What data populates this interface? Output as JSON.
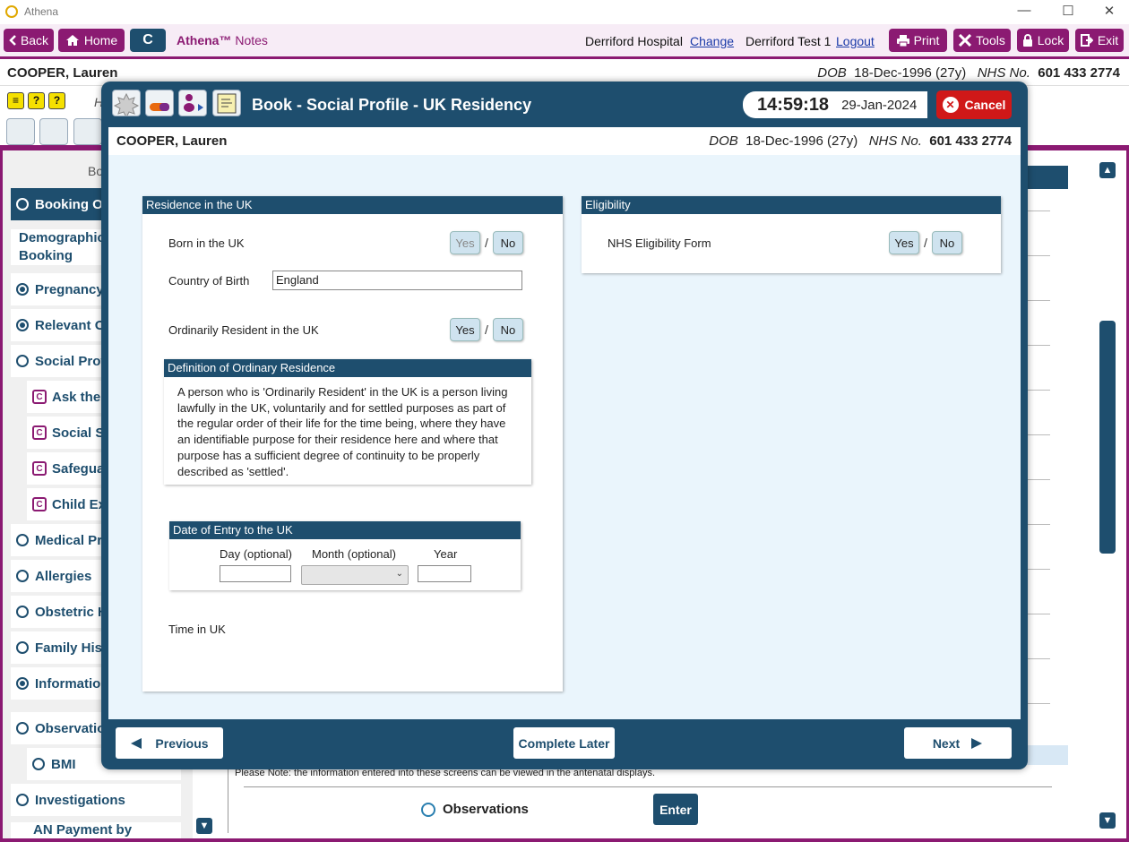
{
  "window": {
    "title": "Athena",
    "minimize": "—",
    "maximize": "☐",
    "close": "✕"
  },
  "nav": {
    "back": "Back",
    "home": "Home",
    "c": "C",
    "brand": "Athena™",
    "brand_suffix": "Notes",
    "hospital": "Derriford Hospital",
    "change": "Change",
    "user": "Derriford Test 1",
    "logout": "Logout",
    "print": "Print",
    "tools": "Tools",
    "lock": "Lock",
    "exit": "Exit"
  },
  "patient": {
    "name": "COOPER, Lauren",
    "dob_label": "DOB",
    "dob": "18-Dec-1996 (27y)",
    "nhs_label": "NHS No.",
    "nhs": "601 433 2774"
  },
  "background": {
    "h_letter": "H",
    "sidebar_header": "Bo",
    "sidebar": [
      {
        "label": "Booking Ov",
        "type": "radio",
        "active": true
      },
      {
        "label": "Demographics\nBooking",
        "type": "text"
      },
      {
        "label": "Pregnancy I",
        "type": "radio",
        "filled": true
      },
      {
        "label": "Relevant Ot",
        "type": "radio",
        "filled": true
      },
      {
        "label": "Social Profil",
        "type": "radio"
      },
      {
        "label": "Ask the",
        "type": "c"
      },
      {
        "label": "Social Se",
        "type": "c"
      },
      {
        "label": "Safegua",
        "type": "c"
      },
      {
        "label": "Child Exp",
        "type": "c"
      },
      {
        "label": "Medical Pro",
        "type": "radio"
      },
      {
        "label": "Allergies",
        "type": "radio"
      },
      {
        "label": "Obstetric H",
        "type": "radio"
      },
      {
        "label": "Family Histo",
        "type": "radio"
      },
      {
        "label": "Information",
        "type": "radio",
        "filled": true
      },
      {
        "label": "Observation",
        "type": "radio"
      },
      {
        "label": "BMI",
        "type": "radio"
      },
      {
        "label": "Investigations",
        "type": "radio"
      },
      {
        "label": "AN Payment by",
        "type": "text"
      }
    ],
    "note": "Please Note: the information entered into these screens can be viewed in the antenatal displays.",
    "observations": "Observations",
    "enter": "Enter"
  },
  "modal": {
    "title": "Book - Social Profile - UK Residency",
    "time": "14:59:18",
    "date": "29-Jan-2024",
    "cancel": "Cancel",
    "residence": {
      "header": "Residence in the UK",
      "born_label": "Born in the UK",
      "yes": "Yes",
      "no": "No",
      "country_label": "Country of Birth",
      "country_value": "England",
      "ordinarily_label": "Ordinarily Resident in the UK",
      "definition_header": "Definition of Ordinary Residence",
      "definition_lines": [
        "A person who is 'Ordinarily Resident' in the UK is a person living",
        "lawfully in the UK, voluntarily and for settled purposes as part of",
        "the regular order of their life for the time being, where they have",
        "an identifiable purpose for their residence here and where that",
        "purpose has a sufficient degree of continuity to be properly",
        "described as 'settled'."
      ],
      "entry_header": "Date of Entry to the UK",
      "day_label": "Day (optional)",
      "month_label": "Month (optional)",
      "year_label": "Year",
      "time_in_uk": "Time in UK"
    },
    "eligibility": {
      "header": "Eligibility",
      "form_label": "NHS Eligibility Form",
      "yes": "Yes",
      "no": "No"
    },
    "footer": {
      "previous": "Previous",
      "complete_later": "Complete Later",
      "next": "Next"
    }
  },
  "colors": {
    "brand_purple": "#8b1a72",
    "navy": "#1e4e6e",
    "cancel_red": "#d01818",
    "body_bg": "#eaf5fc"
  }
}
